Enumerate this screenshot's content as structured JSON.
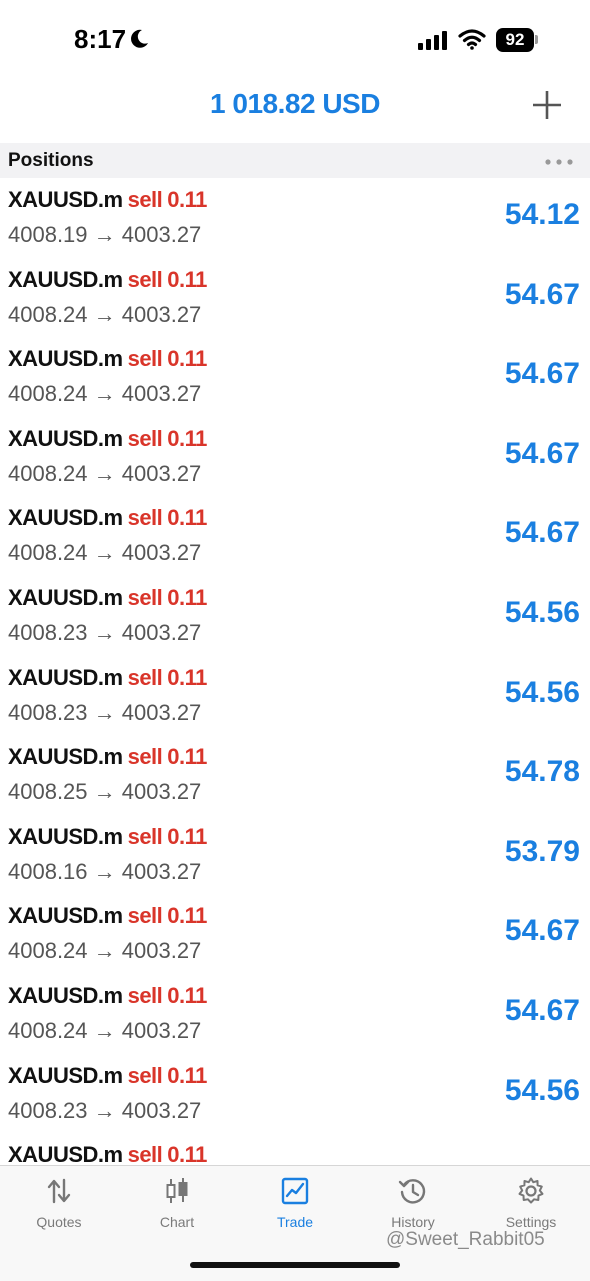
{
  "status_bar": {
    "time": "8:17",
    "battery": "92"
  },
  "header": {
    "balance": "1 018.82 USD"
  },
  "section": {
    "title": "Positions"
  },
  "positions": [
    {
      "symbol": "XAUUSD.m",
      "side": "sell",
      "volume": "0.11",
      "open_price": "4008.19",
      "current_price": "4003.27",
      "profit": "54.12"
    },
    {
      "symbol": "XAUUSD.m",
      "side": "sell",
      "volume": "0.11",
      "open_price": "4008.24",
      "current_price": "4003.27",
      "profit": "54.67"
    },
    {
      "symbol": "XAUUSD.m",
      "side": "sell",
      "volume": "0.11",
      "open_price": "4008.24",
      "current_price": "4003.27",
      "profit": "54.67"
    },
    {
      "symbol": "XAUUSD.m",
      "side": "sell",
      "volume": "0.11",
      "open_price": "4008.24",
      "current_price": "4003.27",
      "profit": "54.67"
    },
    {
      "symbol": "XAUUSD.m",
      "side": "sell",
      "volume": "0.11",
      "open_price": "4008.24",
      "current_price": "4003.27",
      "profit": "54.67"
    },
    {
      "symbol": "XAUUSD.m",
      "side": "sell",
      "volume": "0.11",
      "open_price": "4008.23",
      "current_price": "4003.27",
      "profit": "54.56"
    },
    {
      "symbol": "XAUUSD.m",
      "side": "sell",
      "volume": "0.11",
      "open_price": "4008.23",
      "current_price": "4003.27",
      "profit": "54.56"
    },
    {
      "symbol": "XAUUSD.m",
      "side": "sell",
      "volume": "0.11",
      "open_price": "4008.25",
      "current_price": "4003.27",
      "profit": "54.78"
    },
    {
      "symbol": "XAUUSD.m",
      "side": "sell",
      "volume": "0.11",
      "open_price": "4008.16",
      "current_price": "4003.27",
      "profit": "53.79"
    },
    {
      "symbol": "XAUUSD.m",
      "side": "sell",
      "volume": "0.11",
      "open_price": "4008.24",
      "current_price": "4003.27",
      "profit": "54.67"
    },
    {
      "symbol": "XAUUSD.m",
      "side": "sell",
      "volume": "0.11",
      "open_price": "4008.24",
      "current_price": "4003.27",
      "profit": "54.67"
    },
    {
      "symbol": "XAUUSD.m",
      "side": "sell",
      "volume": "0.11",
      "open_price": "4008.23",
      "current_price": "4003.27",
      "profit": "54.56"
    },
    {
      "symbol": "XAUUSD.m",
      "side": "sell",
      "volume": "0.11",
      "open_price": "",
      "current_price": "",
      "profit": ""
    }
  ],
  "tabs": [
    {
      "label": "Quotes",
      "icon": "arrows-updown-icon",
      "active": false
    },
    {
      "label": "Chart",
      "icon": "candlestick-icon",
      "active": false
    },
    {
      "label": "Trade",
      "icon": "trade-chart-icon",
      "active": true
    },
    {
      "label": "History",
      "icon": "history-icon",
      "active": false
    },
    {
      "label": "Settings",
      "icon": "gear-icon",
      "active": false
    }
  ],
  "watermark": "@Sweet_Rabbit05",
  "colors": {
    "accent": "#1a7fe0",
    "sell": "#d9352a"
  }
}
